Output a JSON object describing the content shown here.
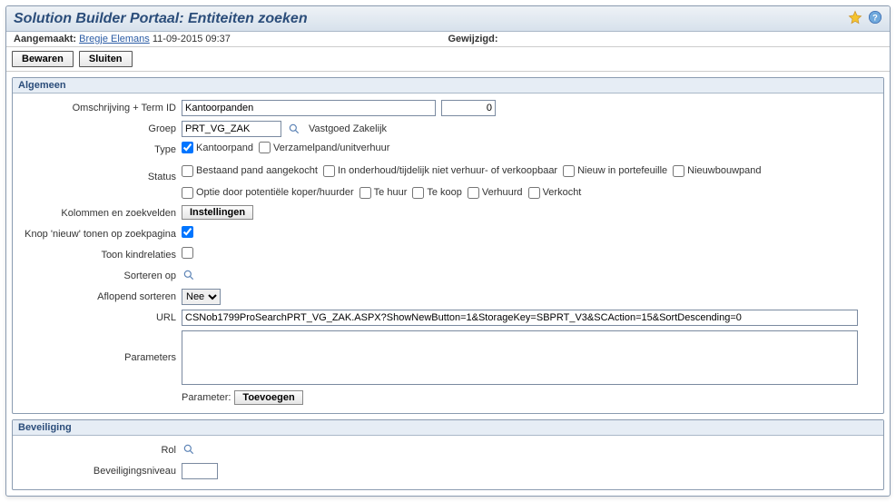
{
  "title": "Solution Builder Portaal: Entiteiten zoeken",
  "meta": {
    "created_label": "Aangemaakt:",
    "created_by": "Bregje Elemans",
    "created_at": "11-09-2015 09:37",
    "modified_label": "Gewijzigd:"
  },
  "actions": {
    "save": "Bewaren",
    "close": "Sluiten"
  },
  "sections": {
    "general": "Algemeen",
    "security": "Beveiliging"
  },
  "labels": {
    "desc_term": "Omschrijving + Term ID",
    "group": "Groep",
    "type": "Type",
    "status": "Status",
    "columns": "Kolommen en zoekvelden",
    "show_new": "Knop 'nieuw' tonen op zoekpagina",
    "child_rel": "Toon kindrelaties",
    "sort_on": "Sorteren op",
    "sort_desc": "Aflopend sorteren",
    "url": "URL",
    "parameters": "Parameters",
    "parameter_add_label": "Parameter:",
    "role": "Rol",
    "sec_level": "Beveiligingsniveau"
  },
  "values": {
    "description": "Kantoorpanden",
    "term_id": "0",
    "group": "PRT_VG_ZAK",
    "group_display": "Vastgoed Zakelijk",
    "url": "CSNob1799ProSearchPRT_VG_ZAK.ASPX?ShowNewButton=1&StorageKey=SBPRT_V3&SCAction=15&SortDescending=0",
    "parameters": ""
  },
  "type_options": [
    {
      "label": "Kantoorpand",
      "checked": true
    },
    {
      "label": "Verzamelpand/unitverhuur",
      "checked": false
    }
  ],
  "status_options": [
    {
      "label": "Bestaand pand aangekocht",
      "checked": false
    },
    {
      "label": "In onderhoud/tijdelijk niet verhuur- of verkoopbaar",
      "checked": false
    },
    {
      "label": "Nieuw in portefeuille",
      "checked": false
    },
    {
      "label": "Nieuwbouwpand",
      "checked": false
    },
    {
      "label": "Optie door potentiële koper/huurder",
      "checked": false
    },
    {
      "label": "Te huur",
      "checked": false
    },
    {
      "label": "Te koop",
      "checked": false
    },
    {
      "label": "Verhuurd",
      "checked": false
    },
    {
      "label": "Verkocht",
      "checked": false
    }
  ],
  "buttons": {
    "settings": "Instellingen",
    "add": "Toevoegen"
  },
  "checkboxes": {
    "show_new": true,
    "child_rel": false
  },
  "sort_desc_options": [
    "Nee"
  ],
  "sort_desc_value": "Nee"
}
